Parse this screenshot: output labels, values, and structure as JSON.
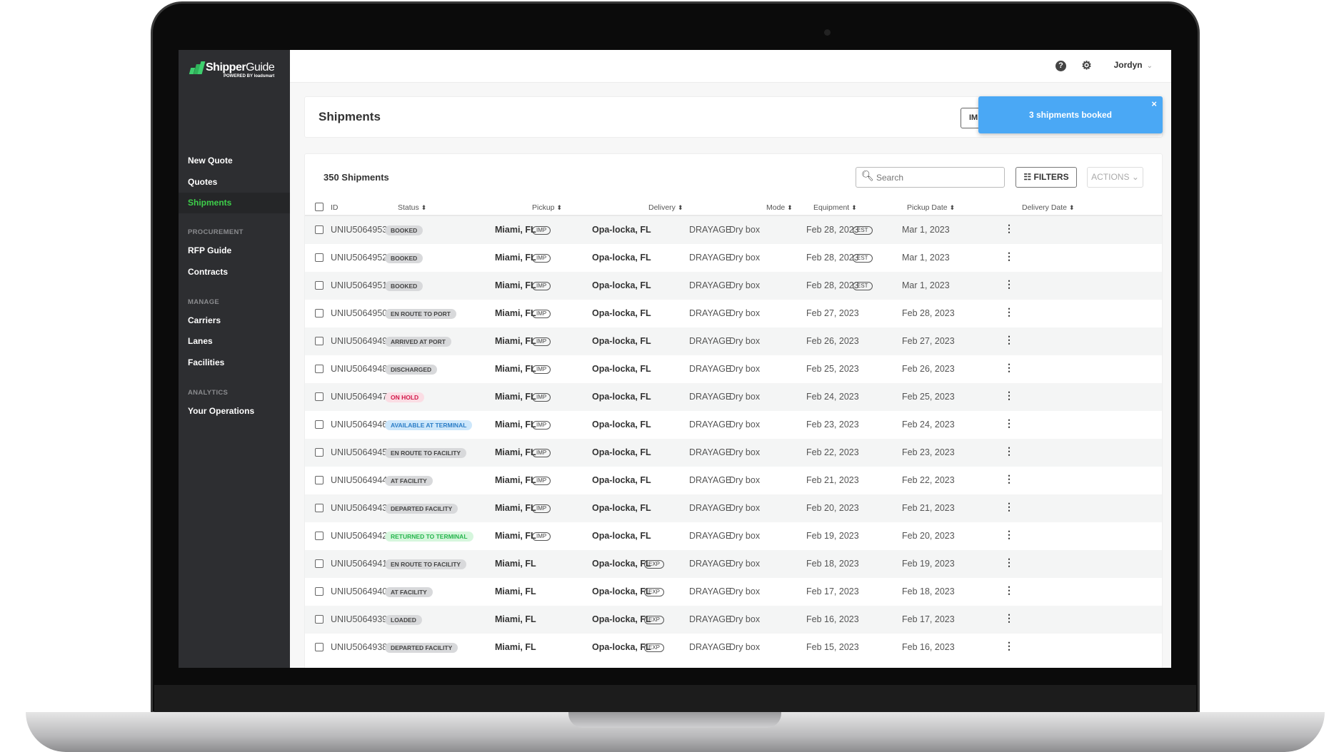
{
  "app": {
    "logo_text_bold": "Shipper",
    "logo_text_light": "Guide",
    "logo_sub": "POWERED BY loadsmart"
  },
  "sidebar": {
    "items": [
      {
        "label": "New Quote"
      },
      {
        "label": "Quotes"
      },
      {
        "label": "Shipments",
        "active": true
      }
    ],
    "sections": [
      {
        "title": "PROCUREMENT",
        "items": [
          {
            "label": "RFP Guide"
          },
          {
            "label": "Contracts"
          }
        ]
      },
      {
        "title": "MANAGE",
        "items": [
          {
            "label": "Carriers"
          },
          {
            "label": "Lanes"
          },
          {
            "label": "Facilities"
          }
        ]
      },
      {
        "title": "ANALYTICS",
        "items": [
          {
            "label": "Your Operations"
          }
        ]
      }
    ]
  },
  "topbar": {
    "help_icon": "question-circle-icon",
    "settings_icon": "gear-icon",
    "user": "Jordyn"
  },
  "page": {
    "title": "Shipments",
    "import_button_partial": "IM"
  },
  "toast": {
    "message": "3 shipments booked",
    "close": "×"
  },
  "table": {
    "count": "350 Shipments",
    "search_placeholder": "Search",
    "filters_label": "FILTERS",
    "actions_label": "ACTIONS",
    "columns": [
      "ID",
      "Status",
      "Pickup",
      "Delivery",
      "Mode",
      "Equipment",
      "Pickup Date",
      "Delivery Date"
    ],
    "rows": [
      {
        "id": "UNIU5064953",
        "status": "BOOKED",
        "tone": "gray",
        "pickup": "Miami, FL",
        "pickup_tag": "IMP",
        "delivery": "Opa-locka, FL",
        "delivery_tag": "",
        "mode": "DRAYAGE",
        "equipment": "Dry box",
        "pickup_date": "Feb 28, 2023",
        "pickup_tag2": "EST",
        "delivery_date": "Mar 1, 2023"
      },
      {
        "id": "UNIU5064952",
        "status": "BOOKED",
        "tone": "gray",
        "pickup": "Miami, FL",
        "pickup_tag": "IMP",
        "delivery": "Opa-locka, FL",
        "delivery_tag": "",
        "mode": "DRAYAGE",
        "equipment": "Dry box",
        "pickup_date": "Feb 28, 2023",
        "pickup_tag2": "EST",
        "delivery_date": "Mar 1, 2023"
      },
      {
        "id": "UNIU5064951",
        "status": "BOOKED",
        "tone": "gray",
        "pickup": "Miami, FL",
        "pickup_tag": "IMP",
        "delivery": "Opa-locka, FL",
        "delivery_tag": "",
        "mode": "DRAYAGE",
        "equipment": "Dry box",
        "pickup_date": "Feb 28, 2023",
        "pickup_tag2": "EST",
        "delivery_date": "Mar 1, 2023"
      },
      {
        "id": "UNIU5064950",
        "status": "EN ROUTE TO PORT",
        "tone": "gray",
        "pickup": "Miami, FL",
        "pickup_tag": "IMP",
        "delivery": "Opa-locka, FL",
        "delivery_tag": "",
        "mode": "DRAYAGE",
        "equipment": "Dry box",
        "pickup_date": "Feb 27, 2023",
        "pickup_tag2": "",
        "delivery_date": "Feb 28, 2023"
      },
      {
        "id": "UNIU5064949",
        "status": "ARRIVED AT PORT",
        "tone": "gray",
        "pickup": "Miami, FL",
        "pickup_tag": "IMP",
        "delivery": "Opa-locka, FL",
        "delivery_tag": "",
        "mode": "DRAYAGE",
        "equipment": "Dry box",
        "pickup_date": "Feb 26, 2023",
        "pickup_tag2": "",
        "delivery_date": "Feb 27, 2023"
      },
      {
        "id": "UNIU5064948",
        "status": "DISCHARGED",
        "tone": "gray",
        "pickup": "Miami, FL",
        "pickup_tag": "IMP",
        "delivery": "Opa-locka, FL",
        "delivery_tag": "",
        "mode": "DRAYAGE",
        "equipment": "Dry box",
        "pickup_date": "Feb 25, 2023",
        "pickup_tag2": "",
        "delivery_date": "Feb 26, 2023"
      },
      {
        "id": "UNIU5064947",
        "status": "ON HOLD",
        "tone": "red",
        "pickup": "Miami, FL",
        "pickup_tag": "IMP",
        "delivery": "Opa-locka, FL",
        "delivery_tag": "",
        "mode": "DRAYAGE",
        "equipment": "Dry box",
        "pickup_date": "Feb 24, 2023",
        "pickup_tag2": "",
        "delivery_date": "Feb 25, 2023"
      },
      {
        "id": "UNIU5064946",
        "status": "AVAILABLE AT TERMINAL",
        "tone": "blue",
        "pickup": "Miami, FL",
        "pickup_tag": "IMP",
        "delivery": "Opa-locka, FL",
        "delivery_tag": "",
        "mode": "DRAYAGE",
        "equipment": "Dry box",
        "pickup_date": "Feb 23, 2023",
        "pickup_tag2": "",
        "delivery_date": "Feb 24, 2023"
      },
      {
        "id": "UNIU5064945",
        "status": "EN ROUTE TO FACILITY",
        "tone": "gray",
        "pickup": "Miami, FL",
        "pickup_tag": "IMP",
        "delivery": "Opa-locka, FL",
        "delivery_tag": "",
        "mode": "DRAYAGE",
        "equipment": "Dry box",
        "pickup_date": "Feb 22, 2023",
        "pickup_tag2": "",
        "delivery_date": "Feb 23, 2023"
      },
      {
        "id": "UNIU5064944",
        "status": "AT FACILITY",
        "tone": "gray",
        "pickup": "Miami, FL",
        "pickup_tag": "IMP",
        "delivery": "Opa-locka, FL",
        "delivery_tag": "",
        "mode": "DRAYAGE",
        "equipment": "Dry box",
        "pickup_date": "Feb 21, 2023",
        "pickup_tag2": "",
        "delivery_date": "Feb 22, 2023"
      },
      {
        "id": "UNIU5064943",
        "status": "DEPARTED FACILITY",
        "tone": "gray",
        "pickup": "Miami, FL",
        "pickup_tag": "IMP",
        "delivery": "Opa-locka, FL",
        "delivery_tag": "",
        "mode": "DRAYAGE",
        "equipment": "Dry box",
        "pickup_date": "Feb 20, 2023",
        "pickup_tag2": "",
        "delivery_date": "Feb 21, 2023"
      },
      {
        "id": "UNIU5064942",
        "status": "RETURNED TO TERMINAL",
        "tone": "green",
        "pickup": "Miami, FL",
        "pickup_tag": "IMP",
        "delivery": "Opa-locka, FL",
        "delivery_tag": "",
        "mode": "DRAYAGE",
        "equipment": "Dry box",
        "pickup_date": "Feb 19, 2023",
        "pickup_tag2": "",
        "delivery_date": "Feb 20, 2023"
      },
      {
        "id": "UNIU5064941",
        "status": "EN ROUTE TO FACILITY",
        "tone": "gray",
        "pickup": "Miami, FL",
        "pickup_tag": "",
        "delivery": "Opa-locka, FL",
        "delivery_tag": "EXP",
        "mode": "DRAYAGE",
        "equipment": "Dry box",
        "pickup_date": "Feb 18, 2023",
        "pickup_tag2": "",
        "delivery_date": "Feb 19, 2023"
      },
      {
        "id": "UNIU5064940",
        "status": "AT FACILITY",
        "tone": "gray",
        "pickup": "Miami, FL",
        "pickup_tag": "",
        "delivery": "Opa-locka, FL",
        "delivery_tag": "EXP",
        "mode": "DRAYAGE",
        "equipment": "Dry box",
        "pickup_date": "Feb 17, 2023",
        "pickup_tag2": "",
        "delivery_date": "Feb 18, 2023"
      },
      {
        "id": "UNIU5064939",
        "status": "LOADED",
        "tone": "gray",
        "pickup": "Miami, FL",
        "pickup_tag": "",
        "delivery": "Opa-locka, FL",
        "delivery_tag": "EXP",
        "mode": "DRAYAGE",
        "equipment": "Dry box",
        "pickup_date": "Feb 16, 2023",
        "pickup_tag2": "",
        "delivery_date": "Feb 17, 2023"
      },
      {
        "id": "UNIU5064938",
        "status": "DEPARTED FACILITY",
        "tone": "gray",
        "pickup": "Miami, FL",
        "pickup_tag": "",
        "delivery": "Opa-locka, FL",
        "delivery_tag": "EXP",
        "mode": "DRAYAGE",
        "equipment": "Dry box",
        "pickup_date": "Feb 15, 2023",
        "pickup_tag2": "",
        "delivery_date": "Feb 16, 2023"
      }
    ]
  },
  "colors": {
    "accent": "#3ecf4a",
    "sidebar_bg": "#2d2e31",
    "toast": "#4aa8f5"
  }
}
